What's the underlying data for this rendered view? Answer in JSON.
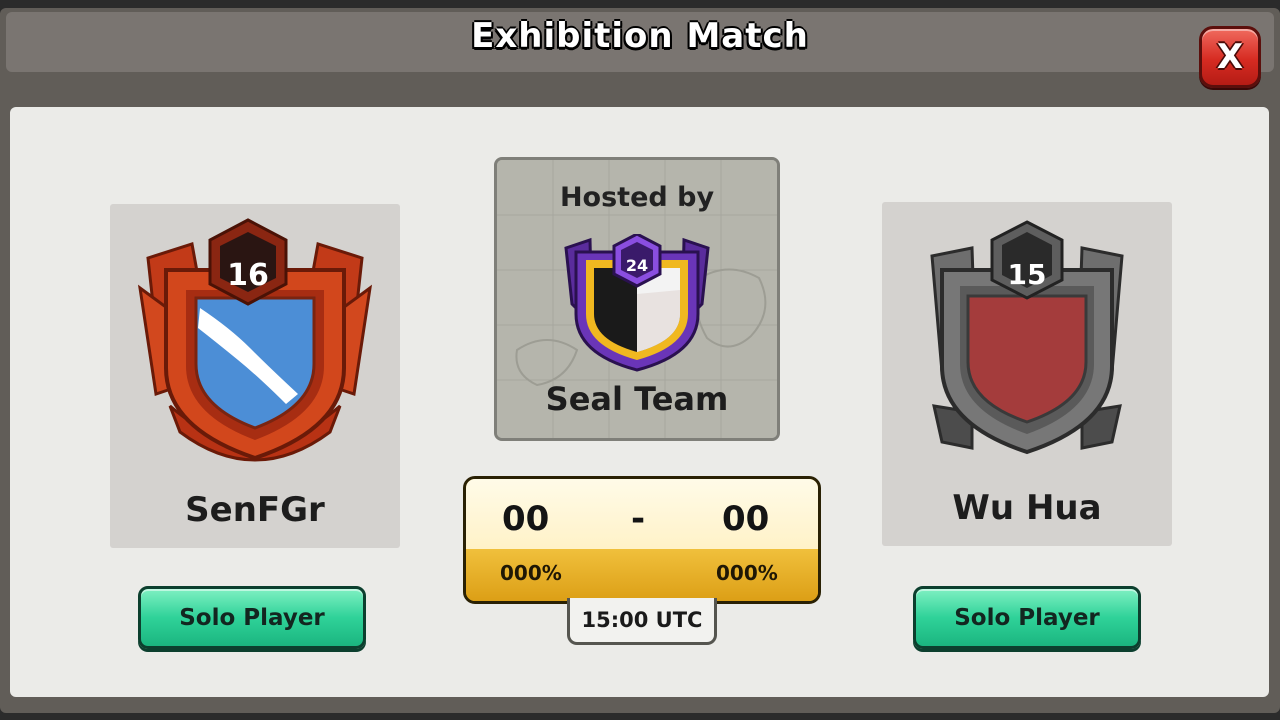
{
  "dialog": {
    "title": "Exhibition Match",
    "close_label": "X"
  },
  "left_clan": {
    "name": "SenFGr",
    "level": "16",
    "button_label": "Solo Player"
  },
  "right_clan": {
    "name": "Wu Hua",
    "level": "15",
    "button_label": "Solo Player"
  },
  "host": {
    "label": "Hosted by",
    "name": "Seal Team",
    "level": "24"
  },
  "score": {
    "left_score": "00",
    "separator": "-",
    "right_score": "00",
    "left_percent": "000%",
    "right_percent": "000%",
    "time": "15:00 UTC"
  },
  "colors": {
    "close_button": "#d62b22",
    "solo_button": "#2fd299",
    "score_accent": "#e3a820"
  }
}
